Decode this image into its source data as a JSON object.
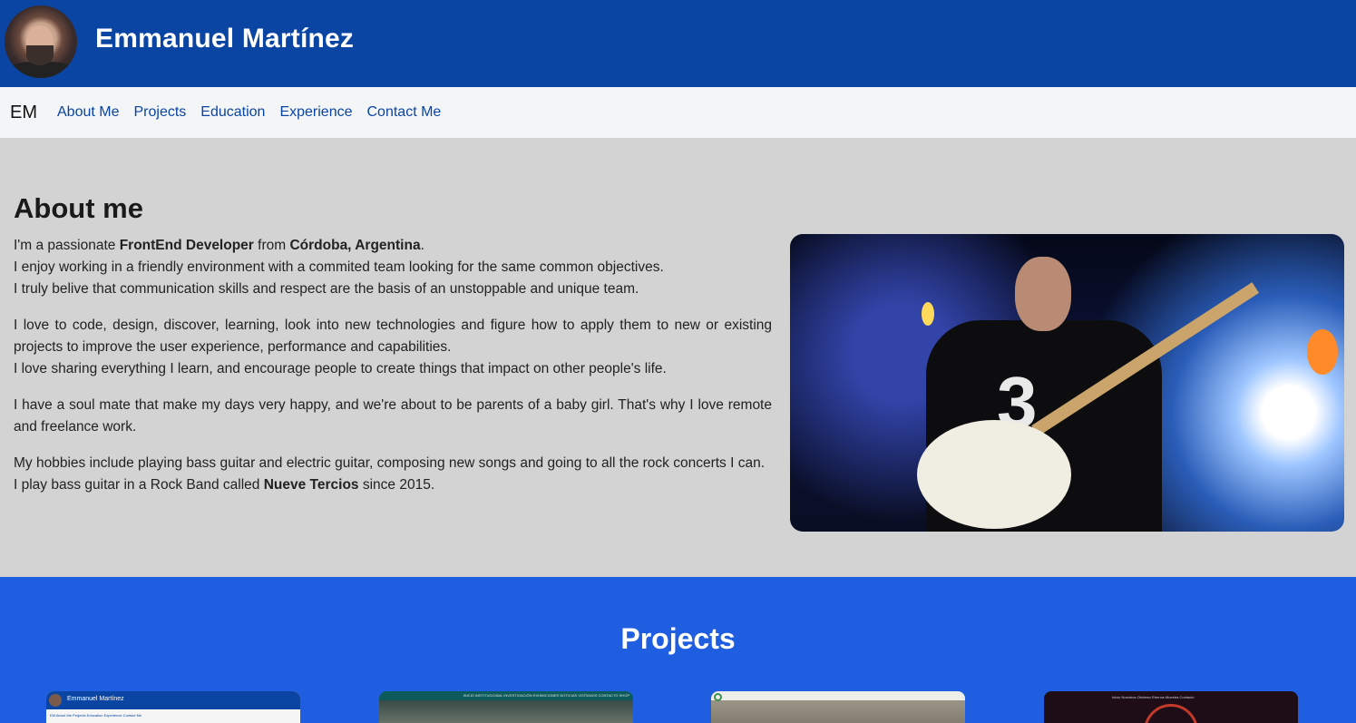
{
  "header": {
    "name": "Emmanuel Martínez"
  },
  "navbar": {
    "brand": "EM",
    "links": [
      "About Me",
      "Projects",
      "Education",
      "Experience",
      "Contact Me"
    ]
  },
  "about": {
    "title": "About me",
    "p1": {
      "t1": "I'm a passionate ",
      "b1": "FrontEnd Developer",
      "t2": " from ",
      "b2": "Córdoba, Argentina",
      "t3": ".",
      "line2": "I enjoy working in a friendly environment with a commited team looking for the same common objectives.",
      "line3": "I truly belive that communication skills and respect are the basis of an unstoppable and unique team."
    },
    "p2": {
      "line1": "I love to code, design, discover, learning, look into new technologies and figure how to apply them to new or existing projects to improve the user experience, performance and capabilities.",
      "line2": "I love sharing everything I learn, and encourage people to create things that impact on other people's life."
    },
    "p3": "I have a soul mate that make my days very happy, and we're about to be parents of a baby girl. That's why I love remote and freelance work.",
    "p4": {
      "line1": "My hobbies include playing bass guitar and electric guitar, composing new songs and going to all the rock concerts I can.",
      "t1": "I play bass guitar in a Rock Band called ",
      "b1": "Nueve Tercios",
      "t2": " since 2015."
    },
    "photo_shirt_number": "3"
  },
  "projects": {
    "title": "Projects",
    "card1": {
      "title": "Emmanuel Martínez",
      "nav": "EM   About Me   Projects   Education   Experience   Contact Me"
    },
    "card2": {
      "nav": "INICIO  INSTITUCIONAL  INVESTIGACIÓN  EXHIBICIONES  NOTICIAS  VISÍTANOS  CONTACTO  SHOP"
    },
    "card4": {
      "nav": "Inicio   Nosotros   Otroteso   Eternos   Muestra   Contacto"
    }
  }
}
